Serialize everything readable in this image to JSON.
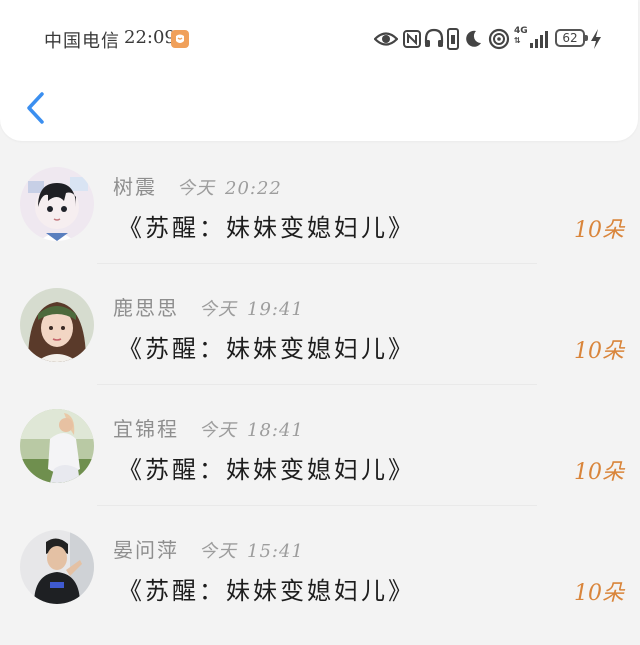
{
  "status_bar": {
    "carrier": "中国电信",
    "time": "22:09",
    "network": "4G",
    "battery": "62"
  },
  "colors": {
    "accent": "#3b8ff0",
    "count": "#d9853b",
    "background": "#f3f3f3"
  },
  "icons": {
    "back": "chevron-left-icon",
    "notification": "notification-app-icon",
    "eye": "eye-icon",
    "nfc": "nfc-icon",
    "headphones": "headphones-icon",
    "vibrate": "vibrate-icon",
    "moon": "moon-icon",
    "hotspot": "hotspot-icon",
    "signal": "signal-icon",
    "charging": "charging-icon"
  },
  "items": [
    {
      "name": "树震",
      "date": "今天",
      "time": "20:22",
      "title": "《苏醒：妹妹变媳妇儿》",
      "count": "10朵"
    },
    {
      "name": "鹿思思",
      "date": "今天",
      "time": "19:41",
      "title": "《苏醒：妹妹变媳妇儿》",
      "count": "10朵"
    },
    {
      "name": "宜锦程",
      "date": "今天",
      "time": "18:41",
      "title": "《苏醒：妹妹变媳妇儿》",
      "count": "10朵"
    },
    {
      "name": "晏问萍",
      "date": "今天",
      "time": "15:41",
      "title": "《苏醒：妹妹变媳妇儿》",
      "count": "10朵"
    }
  ]
}
